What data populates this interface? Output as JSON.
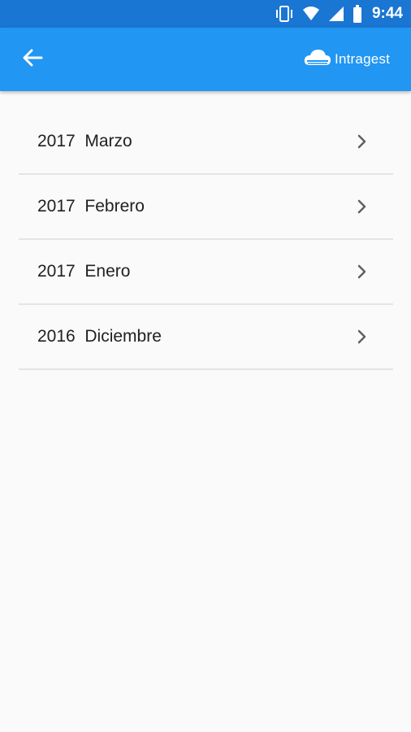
{
  "status_bar": {
    "time": "9:44",
    "icons": [
      "vibrate-icon",
      "wifi-icon",
      "signal-icon",
      "battery-icon"
    ]
  },
  "app_bar": {
    "back_icon": "arrow-left-icon",
    "brand": {
      "logo_icon": "cloud-logo-icon",
      "name": "Intragest"
    }
  },
  "months": [
    {
      "label": "2017  Marzo"
    },
    {
      "label": "2017  Febrero"
    },
    {
      "label": "2017  Enero"
    },
    {
      "label": "2016  Diciembre"
    }
  ],
  "colors": {
    "status_bar": "#1976d2",
    "app_bar": "#2196f3",
    "background": "#fafafa",
    "divider": "#e4e4e4",
    "text": "#212121",
    "chevron": "#616161"
  }
}
